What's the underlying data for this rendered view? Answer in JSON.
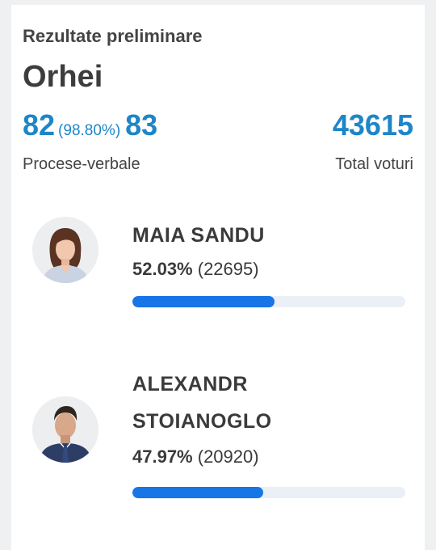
{
  "header": {
    "subtitle": "Rezultate preliminare",
    "region": "Orhei"
  },
  "stats": {
    "processed": "82",
    "processed_pct": "(98.80%)",
    "total_pv": "83",
    "pv_label": "Procese-verbale",
    "total_votes": "43615",
    "votes_label": "Total voturi"
  },
  "candidates": [
    {
      "name_lines": [
        "MAIA SANDU"
      ],
      "percent": "52.03%",
      "votes": "(22695)",
      "share": 0.5203,
      "avatar": "female-portrait-icon"
    },
    {
      "name_lines": [
        "ALEXANDR",
        "STOIANOGLO"
      ],
      "percent": "47.97%",
      "votes": "(20920)",
      "share": 0.4797,
      "avatar": "male-portrait-icon"
    }
  ],
  "colors": {
    "accent": "#1d86c8",
    "bar_fill": "#1775e6",
    "bar_track": "#eaf0f5"
  }
}
